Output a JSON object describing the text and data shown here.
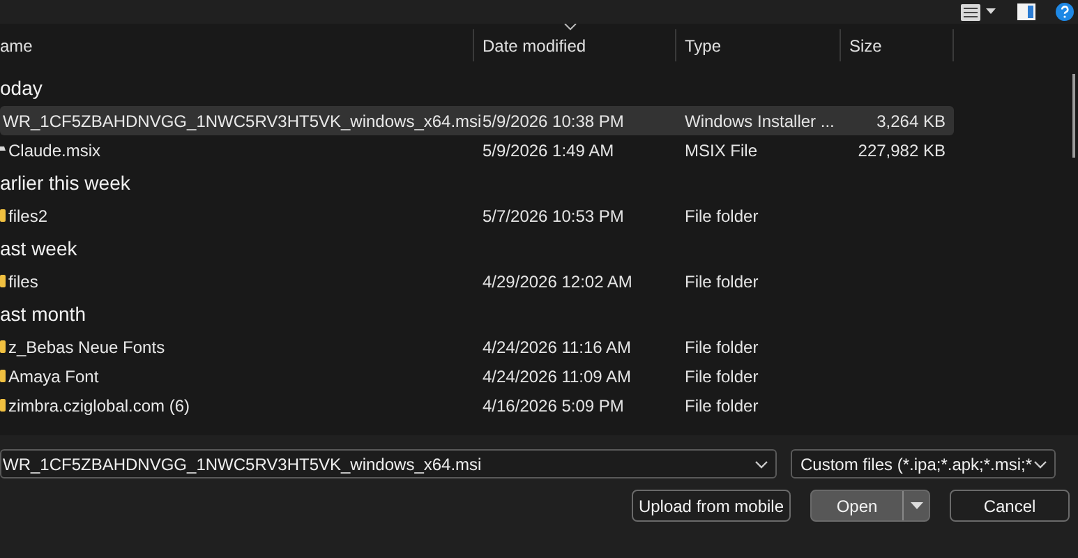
{
  "columns": [
    {
      "label": "ame",
      "sorted": false
    },
    {
      "label": "Date modified",
      "sorted": true
    },
    {
      "label": "Type",
      "sorted": false
    },
    {
      "label": "Size",
      "sorted": false
    }
  ],
  "groups": [
    {
      "label": "oday",
      "rows": [
        {
          "kind": "installer",
          "name": "WR_1CF5ZBAHDNVGG_1NWC5RV3HT5VK_windows_x64.msi",
          "date": "5/9/2026 10:38 PM",
          "type": "Windows Installer ...",
          "size": "3,264 KB",
          "selected": true
        },
        {
          "kind": "file",
          "name": "Claude.msix",
          "date": "5/9/2026 1:49 AM",
          "type": "MSIX File",
          "size": "227,982 KB",
          "selected": false
        }
      ]
    },
    {
      "label": "arlier this week",
      "rows": [
        {
          "kind": "folder",
          "name": "files2",
          "date": "5/7/2026 10:53 PM",
          "type": "File folder",
          "selected": false
        }
      ]
    },
    {
      "label": "ast week",
      "rows": [
        {
          "kind": "folder",
          "name": "files",
          "date": "4/29/2026 12:02 AM",
          "type": "File folder",
          "selected": false
        }
      ]
    },
    {
      "label": "ast month",
      "rows": [
        {
          "kind": "folder",
          "name": "z_Bebas Neue Fonts",
          "date": "4/24/2026 11:16 AM",
          "type": "File folder",
          "selected": false
        },
        {
          "kind": "folder",
          "name": "Amaya Font",
          "date": "4/24/2026 11:09 AM",
          "type": "File folder",
          "selected": false
        },
        {
          "kind": "folder",
          "name": "zimbra.cziglobal.com (6)",
          "date": "4/16/2026 5:09 PM",
          "type": "File folder",
          "selected": false
        }
      ]
    }
  ],
  "filename": {
    "value": "WR_1CF5ZBAHDNVGG_1NWC5RV3HT5VK_windows_x64.msi"
  },
  "filter": {
    "value": "Custom files (*.ipa;*.apk;*.msi;*"
  },
  "buttons": [
    {
      "kind": "plain",
      "label": "Upload from mobile"
    },
    {
      "kind": "split",
      "label": "Open"
    },
    {
      "kind": "plain",
      "label": "Cancel"
    }
  ]
}
